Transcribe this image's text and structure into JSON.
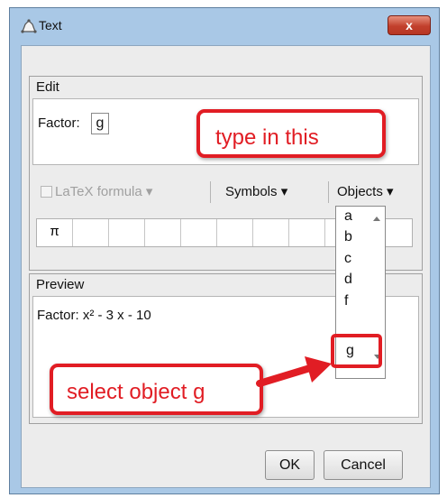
{
  "window": {
    "title": "Text",
    "close_glyph": "x"
  },
  "edit": {
    "heading": "Edit",
    "field_label": "Factor:",
    "field_value": "g"
  },
  "toolbar": {
    "latex_label": "LaTeX formula",
    "symbols_label": "Symbols",
    "objects_label": "Objects",
    "caret": "▾"
  },
  "symbols": {
    "first_symbol": "π"
  },
  "objects_dropdown": {
    "items": [
      "a",
      "b",
      "c",
      "d",
      "f",
      "g"
    ],
    "selected": "g"
  },
  "preview": {
    "heading": "Preview",
    "text": "Factor: x² - 3 x - 10"
  },
  "callouts": {
    "type_hint": "type in this",
    "select_hint": "select object g"
  },
  "buttons": {
    "ok": "OK",
    "cancel": "Cancel"
  },
  "colors": {
    "annotation_red": "#e11d24",
    "window_frame": "#a9c8e6"
  },
  "icons": {
    "window_icon": "text-tool-icon",
    "close": "close-icon"
  }
}
